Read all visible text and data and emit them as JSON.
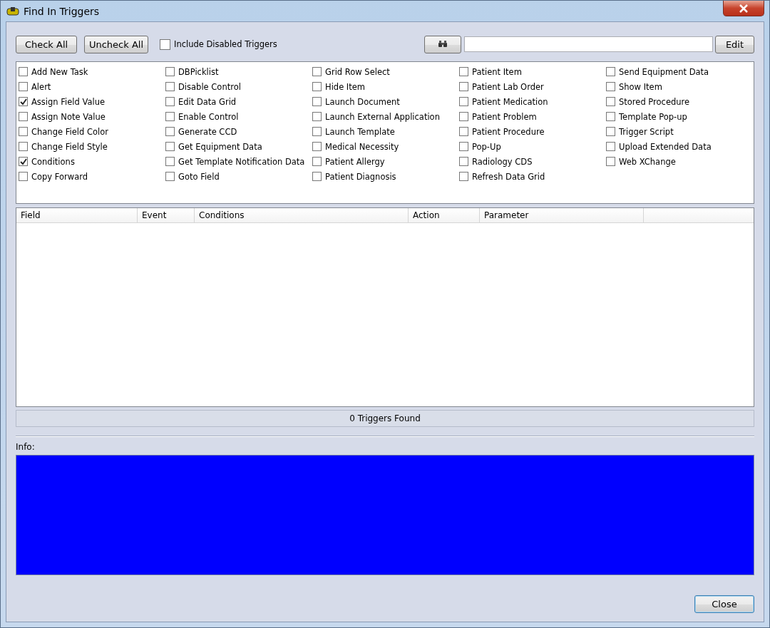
{
  "window": {
    "title": "Find In Triggers"
  },
  "toolbar": {
    "buttons": [
      "Check All",
      "Uncheck All"
    ],
    "include_disabled": {
      "label": "Include Disabled Triggers",
      "checked": false
    },
    "edit_button": "Edit"
  },
  "trigger_columns": [
    [
      {
        "label": "Add New Task",
        "checked": false
      },
      {
        "label": "Alert",
        "checked": false
      },
      {
        "label": "Assign Field Value",
        "checked": true
      },
      {
        "label": "Assign Note Value",
        "checked": false
      },
      {
        "label": "Change Field Color",
        "checked": false
      },
      {
        "label": "Change Field Style",
        "checked": false
      },
      {
        "label": "Conditions",
        "checked": true
      },
      {
        "label": "Copy Forward",
        "checked": false
      }
    ],
    [
      {
        "label": "DBPicklist",
        "checked": false
      },
      {
        "label": "Disable Control",
        "checked": false
      },
      {
        "label": "Edit Data Grid",
        "checked": false
      },
      {
        "label": "Enable Control",
        "checked": false
      },
      {
        "label": "Generate CCD",
        "checked": false
      },
      {
        "label": "Get Equipment Data",
        "checked": false
      },
      {
        "label": "Get Template Notification Data",
        "checked": false
      },
      {
        "label": "Goto Field",
        "checked": false
      }
    ],
    [
      {
        "label": "Grid Row Select",
        "checked": false
      },
      {
        "label": "Hide Item",
        "checked": false
      },
      {
        "label": "Launch Document",
        "checked": false
      },
      {
        "label": "Launch External Application",
        "checked": false
      },
      {
        "label": "Launch Template",
        "checked": false
      },
      {
        "label": "Medical Necessity",
        "checked": false
      },
      {
        "label": "Patient Allergy",
        "checked": false
      },
      {
        "label": "Patient Diagnosis",
        "checked": false
      }
    ],
    [
      {
        "label": "Patient Item",
        "checked": false
      },
      {
        "label": "Patient Lab Order",
        "checked": false
      },
      {
        "label": "Patient Medication",
        "checked": false
      },
      {
        "label": "Patient Problem",
        "checked": false
      },
      {
        "label": "Patient Procedure",
        "checked": false
      },
      {
        "label": "Pop-Up",
        "checked": false
      },
      {
        "label": "Radiology CDS",
        "checked": false
      },
      {
        "label": "Refresh Data Grid",
        "checked": false
      }
    ],
    [
      {
        "label": "Send Equipment Data",
        "checked": false
      },
      {
        "label": "Show Item",
        "checked": false
      },
      {
        "label": "Stored Procedure",
        "checked": false
      },
      {
        "label": "Template Pop-up",
        "checked": false
      },
      {
        "label": "Trigger Script",
        "checked": false
      },
      {
        "label": "Upload Extended Data",
        "checked": false
      },
      {
        "label": "Web XChange",
        "checked": false
      }
    ]
  ],
  "table": {
    "columns": [
      "Field",
      "Event",
      "Conditions",
      "Action",
      "Parameter"
    ]
  },
  "status": "0 Triggers Found",
  "info_label": "Info:",
  "close_button": "Close"
}
